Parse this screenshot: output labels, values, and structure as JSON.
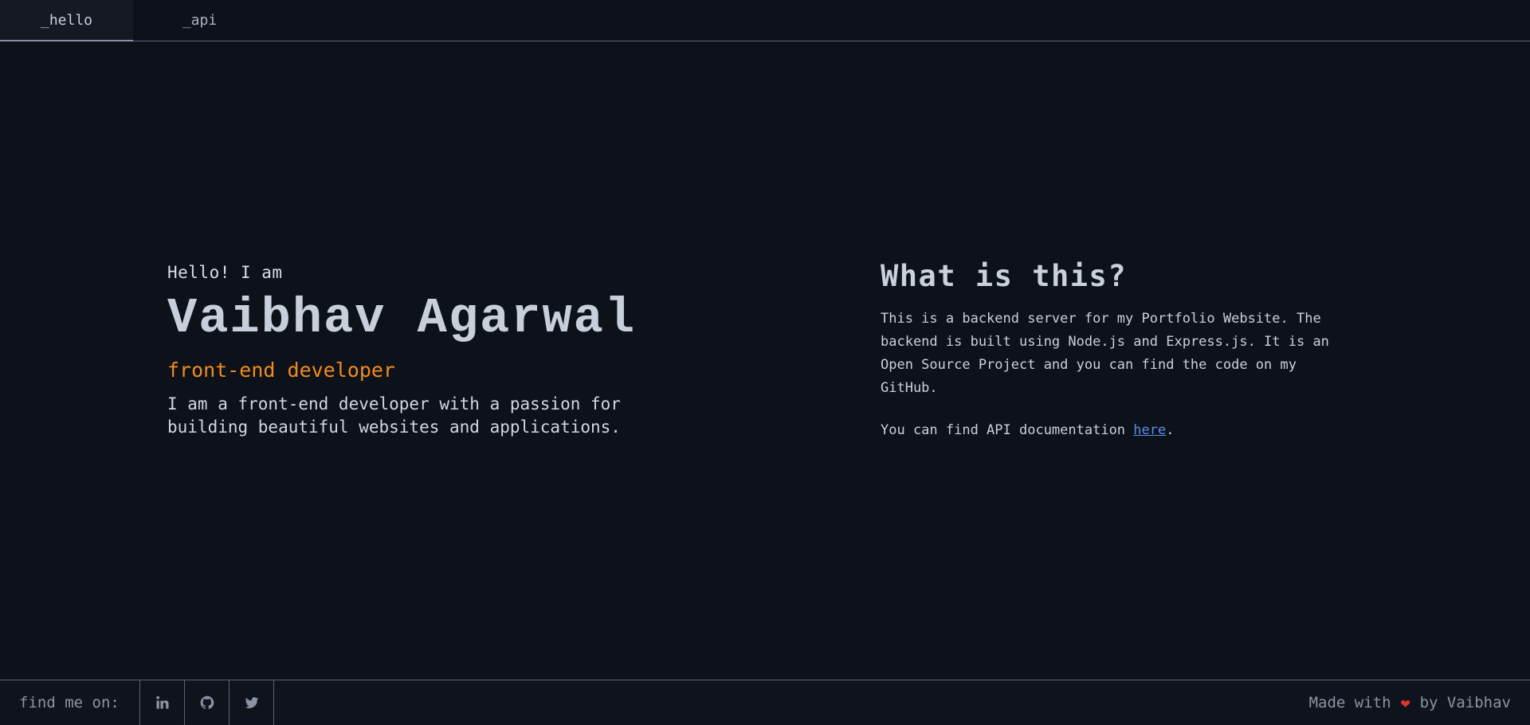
{
  "nav": {
    "tabs": [
      {
        "label": "_hello",
        "active": true
      },
      {
        "label": "_api",
        "active": false
      }
    ]
  },
  "hero": {
    "greeting": "Hello! I am",
    "name": "Vaibhav Agarwal",
    "role": "front-end developer",
    "bio": "I am a front-end developer with a passion for building beautiful websites and applications."
  },
  "info": {
    "title": "What is this?",
    "body": "This is a backend server for my Portfolio Website. The backend is built using Node.js and Express.js. It is an Open Source Project and you can find the code on my GitHub.",
    "doc_prefix": "You can find API documentation ",
    "doc_link": "here",
    "doc_suffix": "."
  },
  "footer": {
    "find_label": "find me on:",
    "socials": [
      "linkedin-icon",
      "github-icon",
      "twitter-icon"
    ],
    "made_prefix": "Made with",
    "made_suffix": "by Vaibhav"
  },
  "colors": {
    "background": "#0d111a",
    "accent_orange": "#f08c1e",
    "link_blue": "#5b8de8",
    "heart_red": "#e0342c"
  }
}
